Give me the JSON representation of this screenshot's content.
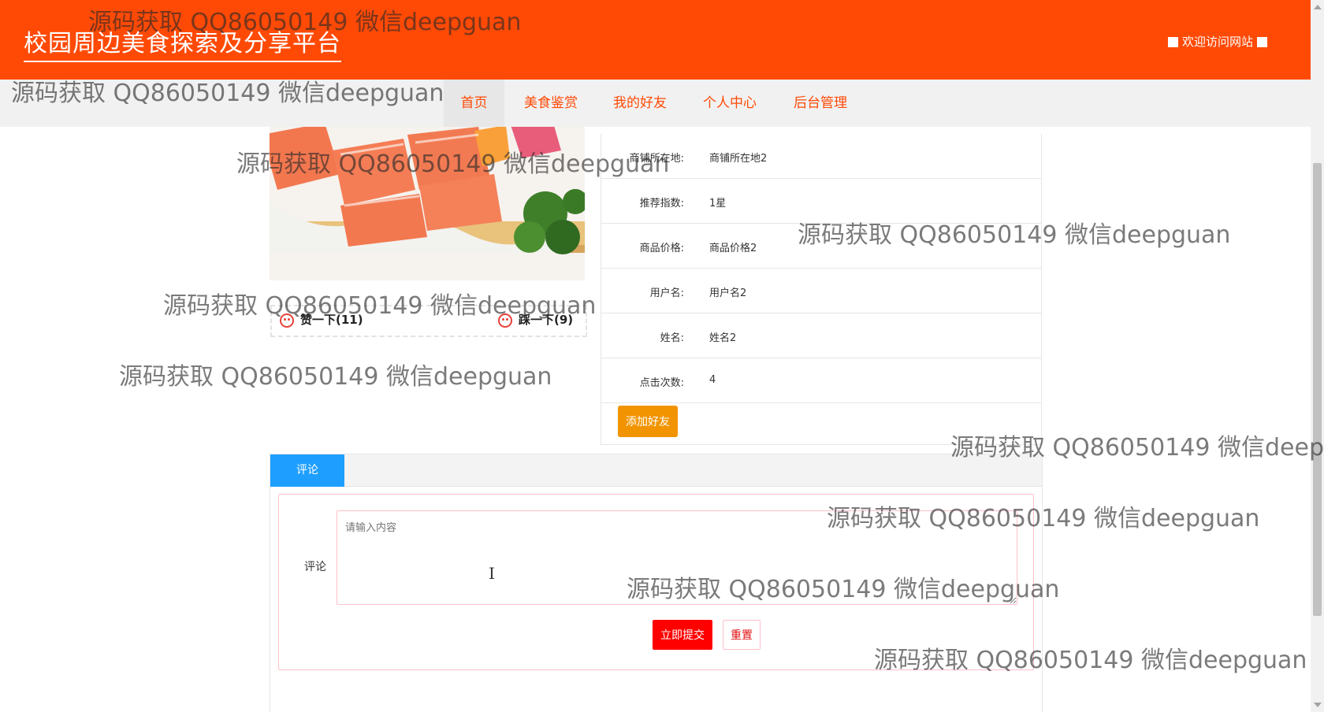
{
  "header": {
    "site_title": "校园周边美食探索及分享平台",
    "welcome": "欢迎访问网站"
  },
  "nav": {
    "items": [
      "首页",
      "美食鉴赏",
      "我的好友",
      "个人中心",
      "后台管理"
    ],
    "active_index": 0
  },
  "votes": {
    "like_label": "赞一下(11)",
    "dislike_label": "踩一下(9)"
  },
  "detail": {
    "rows": [
      {
        "label": "商铺所在地:",
        "value": "商铺所在地2"
      },
      {
        "label": "推荐指数:",
        "value": "1星"
      },
      {
        "label": "商品价格:",
        "value": "商品价格2"
      },
      {
        "label": "用户名:",
        "value": "用户名2"
      },
      {
        "label": "姓名:",
        "value": "姓名2"
      },
      {
        "label": "点击次数:",
        "value": "4"
      }
    ],
    "add_friend_label": "添加好友"
  },
  "comment": {
    "tab_label": "评论",
    "field_label": "评论",
    "placeholder": "请输入内容",
    "submit_label": "立即提交",
    "reset_label": "重置"
  },
  "watermark_text": "源码获取 QQ86050149 微信deepguan",
  "colors": {
    "header_bg": "#ff4a06",
    "tab_blue": "#1e9fff",
    "friend_button": "#f29400",
    "submit_button": "#ff0000"
  }
}
